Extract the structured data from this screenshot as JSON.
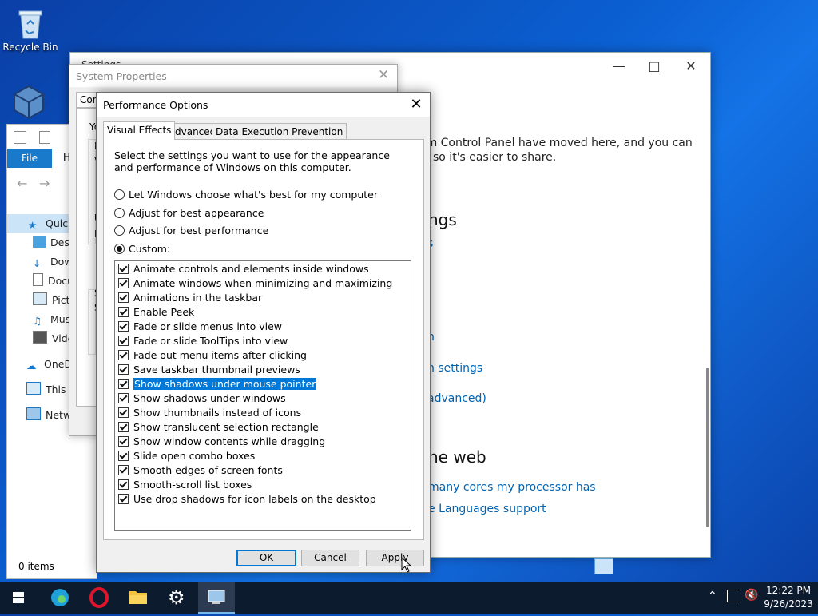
{
  "desktop": {
    "recycle_bin": "Recycle Bin"
  },
  "settings_window": {
    "title_partial": "Settings",
    "body_line1": "om Control Panel have moved here, and you can",
    "body_line2": "so it's easier to share.",
    "heading1": "ngs",
    "link1": "s",
    "link2": "n",
    "link3": "n settings",
    "link4": "advanced)",
    "heading2": "he web",
    "link5": "many cores my processor has",
    "link6": "e Languages support"
  },
  "explorer": {
    "file_tab": "File",
    "home_tab": "H",
    "nav": [
      "Quick",
      "Desk",
      "Dow",
      "Docu",
      "Pictu",
      "Musi",
      "Vide",
      "OneDr",
      "This P",
      "Netwo"
    ],
    "status": "0 items"
  },
  "system_properties": {
    "title": "System Properties",
    "tab_partial": "Com",
    "frag1": "Yo",
    "frag2": "P",
    "frag3": "V",
    "frag4": "U",
    "frag5": "D",
    "frag6": "S",
    "frag7": "S"
  },
  "performance_options": {
    "title": "Performance Options",
    "tabs": [
      "Visual Effects",
      "Advanced",
      "Data Execution Prevention"
    ],
    "description": "Select the settings you want to use for the appearance and performance of Windows on this computer.",
    "radios": [
      {
        "label": "Let Windows choose what's best for my computer",
        "selected": false
      },
      {
        "label": "Adjust for best appearance",
        "selected": false
      },
      {
        "label": "Adjust for best performance",
        "selected": false
      },
      {
        "label": "Custom:",
        "selected": true
      }
    ],
    "options": [
      "Animate controls and elements inside windows",
      "Animate windows when minimizing and maximizing",
      "Animations in the taskbar",
      "Enable Peek",
      "Fade or slide menus into view",
      "Fade or slide ToolTips into view",
      "Fade out menu items after clicking",
      "Save taskbar thumbnail previews",
      "Show shadows under mouse pointer",
      "Show shadows under windows",
      "Show thumbnails instead of icons",
      "Show translucent selection rectangle",
      "Show window contents while dragging",
      "Slide open combo boxes",
      "Smooth edges of screen fonts",
      "Smooth-scroll list boxes",
      "Use drop shadows for icon labels on the desktop"
    ],
    "highlighted_option": "Show shadows under mouse pointer",
    "buttons": {
      "ok": "OK",
      "cancel": "Cancel",
      "apply": "Apply"
    }
  },
  "taskbar": {
    "time": "12:22 PM",
    "date": "9/26/2023"
  },
  "colors": {
    "accent": "#0078d7",
    "link": "#0063b1",
    "taskbar": "#0d1b2f"
  }
}
